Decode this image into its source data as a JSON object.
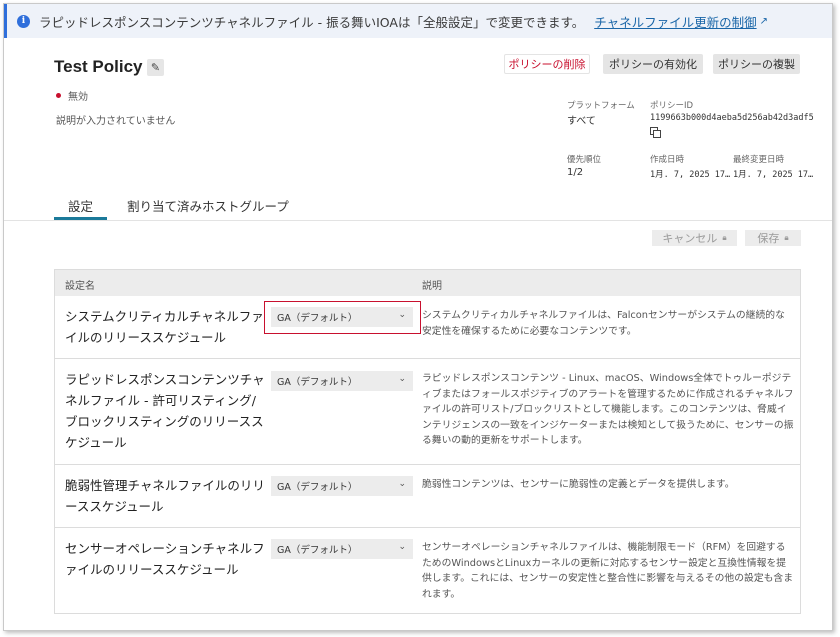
{
  "banner": {
    "icon": "info-icon",
    "text": "ラピッドレスポンスコンテンツチャネルファイル - 振る舞いIOAは「全般設定」で変更できます。",
    "link": "チャネルファイル更新の制御",
    "link_icon": "external-link-icon"
  },
  "policy": {
    "title": "Test Policy",
    "status": "無効",
    "status_color": "#c8102e",
    "description": "説明が入力されていません"
  },
  "actions": {
    "delete": "ポリシーの削除",
    "enable": "ポリシーの有効化",
    "duplicate": "ポリシーの複製"
  },
  "meta": {
    "platform_label": "プラットフォーム",
    "platform_value": "すべて",
    "policy_id_label": "ポリシーID",
    "policy_id_value": "1199663b000d4aeba5d256ab42d3adf5",
    "precedence_label": "優先順位",
    "precedence_value": "1/2",
    "created_label": "作成日時",
    "created_value": "1月. 7, 2025 17…",
    "modified_label": "最終変更日時",
    "modified_value": "1月. 7, 2025 17…"
  },
  "tabs": [
    {
      "label": "設定",
      "active": true
    },
    {
      "label": "割り当て済みホストグループ",
      "active": false
    }
  ],
  "settings_actions": {
    "cancel": "キャンセル",
    "save": "保存"
  },
  "table": {
    "header_name": "設定名",
    "header_desc": "説明",
    "rows": [
      {
        "name": "システムクリティカルチャネルファイルのリリーススケジュール",
        "value": "GA（デフォルト）",
        "description": "システムクリティカルチャネルファイルは、Falconセンサーがシステムの継続的な安定性を確保するために必要なコンテンツです。"
      },
      {
        "name": "ラピッドレスポンスコンテンツチャネルファイル - 許可リスティング/ブロックリスティングのリリーススケジュール",
        "value": "GA（デフォルト）",
        "description": "ラピッドレスポンスコンテンツ - Linux、macOS、Windows全体でトゥルーポジティブまたはフォールスポジティブのアラートを管理するために作成されるチャネルファイルの許可リスト/ブロックリストとして機能します。このコンテンツは、脅威インテリジェンスの一致をインジケーターまたは検知として扱うために、センサーの振る舞いの動的更新をサポートします。"
      },
      {
        "name": "脆弱性管理チャネルファイルのリリーススケジュール",
        "value": "GA（デフォルト）",
        "description": "脆弱性コンテンツは、センサーに脆弱性の定義とデータを提供します。"
      },
      {
        "name": "センサーオペレーションチャネルファイルのリリーススケジュール",
        "value": "GA（デフォルト）",
        "description": "センサーオペレーションチャネルファイルは、機能制限モード（RFM）を回避するためのWindowsとLinuxカーネルの更新に対応するセンサー設定と互換性情報を提供します。これには、センサーの安定性と整合性に影響を与えるその他の設定も含まれます。"
      }
    ]
  }
}
